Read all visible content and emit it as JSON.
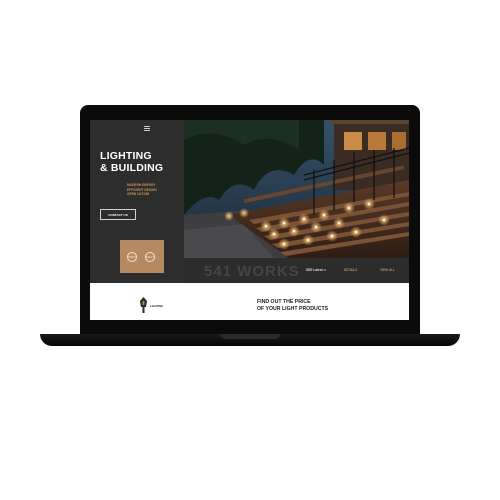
{
  "hero": {
    "title_line1": "LIGHTING",
    "title_line2": "& BUILDING",
    "subtitle_lines": [
      "MODERN ENERGY",
      "EFFICIENT DESIGN",
      "OPEN 24/7/365"
    ],
    "contact_label": "CONTACT US"
  },
  "slider": {
    "prev_label": "PREV",
    "next_label": "NEXT"
  },
  "works_bar": {
    "heading": "541 WORKS",
    "link1": "SEE Latest ⊃",
    "link2": "DETAILS",
    "link3": "VIEW ALL"
  },
  "cta": {
    "line1": "FIND OUT THE PRICE",
    "line2": "OF YOUR LIGHT PRODUCTS"
  },
  "logo": {
    "text": "LIGHTING"
  },
  "colors": {
    "accent": "#b58a62",
    "panel": "#2d2d2d",
    "laptop": "#0b0b0b"
  }
}
